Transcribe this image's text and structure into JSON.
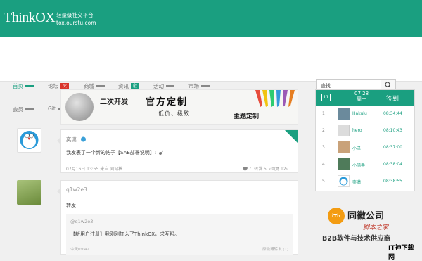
{
  "brand": {
    "logo": "ThinkOX",
    "tagline": "轻量级社交平台",
    "domain": "tox.ourstu.com"
  },
  "nav": {
    "row1": [
      {
        "label": "首页",
        "active": true
      },
      {
        "label": "论坛",
        "badge": "火",
        "badge_color": "#d9342b"
      },
      {
        "label": "商城"
      },
      {
        "label": "资讯",
        "badge": "叡",
        "badge_color": "#1a9f80"
      },
      {
        "label": "活动"
      },
      {
        "label": "市场"
      }
    ],
    "row2": [
      {
        "label": "会员"
      },
      {
        "label": "Git"
      }
    ]
  },
  "search": {
    "value": "查找"
  },
  "banner": {
    "text1": "二次开发",
    "text2": "官方定制",
    "text3": "低价、极致",
    "text4": "主题定制"
  },
  "posts": [
    {
      "user": "奕潇",
      "text": "我发表了一个新的帖子【SAE部署说明】:",
      "meta": "07月16日 13:55 来自 同站稿",
      "likes": "7",
      "repost": "转发 5",
      "reply": "回复 12"
    },
    {
      "user": "q1w2e3",
      "text": "转发",
      "quote": {
        "user": "@q1w2e3",
        "text": "【新用户注册】我刚刚加入了ThinkOX，求互粉。",
        "meta": "今天09:42",
        "actions": "原微博转发 (1)"
      }
    }
  ],
  "checkin": {
    "date_top": "07 28",
    "date_bottom": "周一",
    "button": "签到",
    "rows": [
      {
        "num": "1",
        "name": "Hakulu",
        "time": "08:34:44"
      },
      {
        "num": "2",
        "name": "hero",
        "time": "08:10:43"
      },
      {
        "num": "3",
        "name": "小泽一",
        "time": "08:37:00"
      },
      {
        "num": "4",
        "name": "小骑手",
        "time": "08:38:04"
      },
      {
        "num": "5",
        "name": "奕潇",
        "time": "08:38:55"
      }
    ]
  },
  "ad": {
    "logo": "iTh",
    "name": "同徽公司",
    "site": "脚本之家",
    "slogan": "B2B软件与技术供应商",
    "watermark": "IT神下载网"
  }
}
